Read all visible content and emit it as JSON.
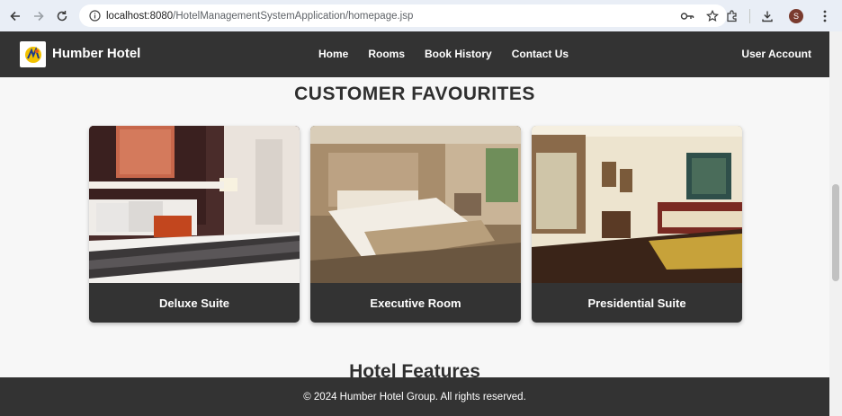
{
  "browser": {
    "url_host": "localhost:8080",
    "url_path": "/HotelManagementSystemApplication/homepage.jsp",
    "profile_initial": "S"
  },
  "header": {
    "brand": "Humber Hotel",
    "nav": [
      "Home",
      "Rooms",
      "Book History",
      "Contact Us"
    ],
    "account": "User Account"
  },
  "main": {
    "section_title": "CUSTOMER FAVOURITES",
    "rooms": [
      {
        "name": "Deluxe Suite"
      },
      {
        "name": "Executive Room"
      },
      {
        "name": "Presidential Suite"
      }
    ],
    "features_title": "Hotel Features"
  },
  "footer": {
    "text": "© 2024 Humber Hotel Group. All rights reserved."
  }
}
